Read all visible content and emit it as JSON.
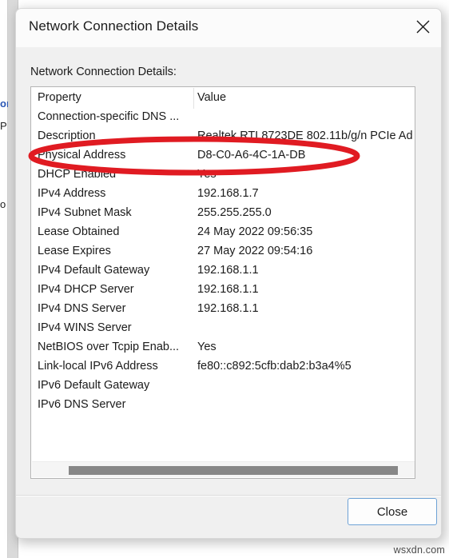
{
  "background_window": {
    "fragment_link": "or",
    "fragment_p": "P",
    "fragment_o": "o"
  },
  "dialog": {
    "title": "Network Connection Details",
    "close_x_icon": "close-icon",
    "details_label": "Network Connection Details:",
    "table": {
      "columns": [
        "Property",
        "Value"
      ],
      "rows": [
        {
          "property": "Connection-specific DNS ...",
          "value": ""
        },
        {
          "property": "Description",
          "value": "Realtek RTL8723DE 802.11b/g/n PCIe Ad"
        },
        {
          "property": "Physical Address",
          "value": "D8-C0-A6-4C-1A-DB"
        },
        {
          "property": "DHCP Enabled",
          "value": "Yes"
        },
        {
          "property": "IPv4 Address",
          "value": "192.168.1.7"
        },
        {
          "property": "IPv4 Subnet Mask",
          "value": "255.255.255.0"
        },
        {
          "property": "Lease Obtained",
          "value": "24 May 2022 09:56:35"
        },
        {
          "property": "Lease Expires",
          "value": "27 May 2022 09:54:16"
        },
        {
          "property": "IPv4 Default Gateway",
          "value": "192.168.1.1"
        },
        {
          "property": "IPv4 DHCP Server",
          "value": "192.168.1.1"
        },
        {
          "property": "IPv4 DNS Server",
          "value": "192.168.1.1"
        },
        {
          "property": "IPv4 WINS Server",
          "value": ""
        },
        {
          "property": "NetBIOS over Tcpip Enab...",
          "value": "Yes"
        },
        {
          "property": "Link-local IPv6 Address",
          "value": "fe80::c892:5cfb:dab2:b3a4%5"
        },
        {
          "property": "IPv6 Default Gateway",
          "value": ""
        },
        {
          "property": "IPv6 DNS Server",
          "value": ""
        }
      ]
    },
    "scrollbar": {
      "orientation": "horizontal"
    },
    "close_button": "Close"
  },
  "annotation": {
    "shape": "ellipse",
    "color": "#E01B22",
    "target_row": "Physical Address"
  },
  "watermark": "wsxdn.com"
}
